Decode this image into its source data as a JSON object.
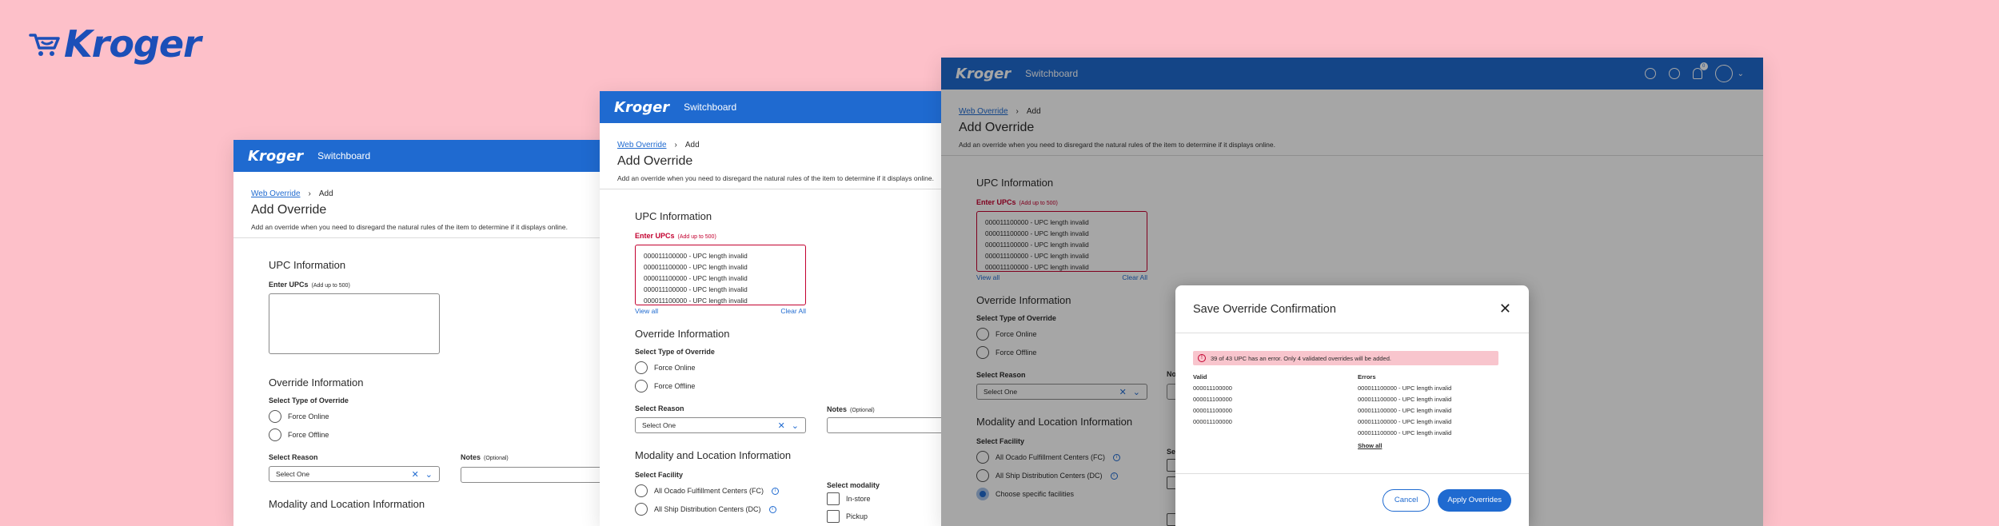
{
  "brand": {
    "logo_text": "Kroger",
    "mini_logo": "Kroger",
    "accent": "#1f6ad0",
    "error": "#c3002f",
    "background": "#fdc0c9"
  },
  "app": {
    "title": "Switchboard"
  },
  "breadcrumb": {
    "link": "Web Override",
    "current": "Add"
  },
  "page": {
    "title": "Add Override",
    "description": "Add an override when you need to disregard the natural rules of the item to determine if it displays online."
  },
  "upc": {
    "section": "UPC Information",
    "label": "Enter UPCs",
    "hint": "(Add up to 500)",
    "error_lines": [
      "000011100000 - UPC length invalid",
      "000011100000 - UPC length invalid",
      "000011100000 - UPC length invalid",
      "000011100000 - UPC length invalid",
      "000011100000 - UPC length invalid"
    ],
    "view_all": "View all",
    "clear_all": "Clear All"
  },
  "override": {
    "section": "Override Information",
    "type_label": "Select Type of Override",
    "options": [
      "Force Online",
      "Force Offline"
    ],
    "reason_label": "Select Reason",
    "reason_value": "Select One",
    "notes_label": "Notes",
    "notes_hint": "(Optional)"
  },
  "modality": {
    "section": "Modality and Location Information",
    "facility_label": "Select Facility",
    "facilities": [
      "All Ocado Fulfillment Centers (FC)",
      "All Ship Distribution Centers (DC)",
      "Choose specific facilities"
    ],
    "modality_label": "Select modality",
    "modalities": [
      "In-store",
      "Pickup"
    ],
    "truncated_label": "Se"
  },
  "header_badge": "0",
  "modal": {
    "title": "Save Override Confirmation",
    "alert": "39 of 43 UPC has an error. Only 4 validated overrides will be added.",
    "valid_header": "Valid",
    "errors_header": "Errors",
    "valid": [
      "000011100000",
      "000011100000",
      "000011100000",
      "000011100000"
    ],
    "errors": [
      "000011100000 - UPC length invalid",
      "000011100000 - UPC length invalid",
      "000011100000 - UPC length invalid",
      "000011100000 - UPC length invalid",
      "000011100000 - UPC length invalid"
    ],
    "show_all": "Show all",
    "cancel": "Cancel",
    "apply": "Apply Overrides"
  }
}
